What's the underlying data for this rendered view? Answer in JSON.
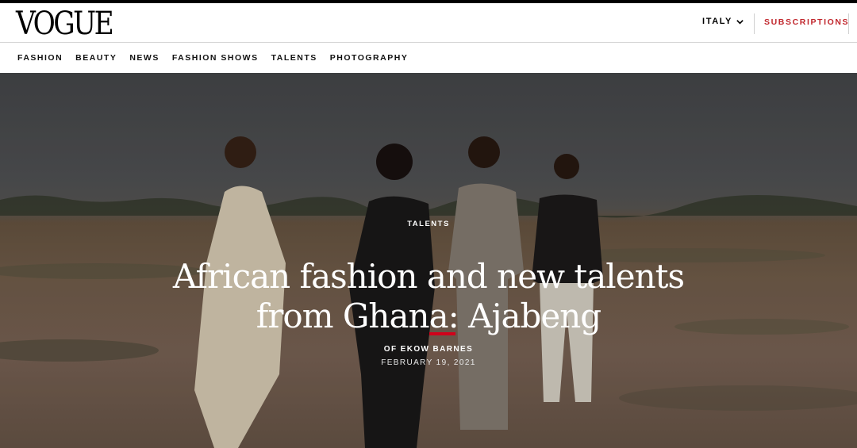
{
  "header": {
    "logo": "VOGUE",
    "region_label": "ITALY",
    "subscriptions_label": "SUBSCRIPTIONS"
  },
  "nav": {
    "items": [
      "FASHION",
      "BEAUTY",
      "NEWS",
      "FASHION SHOWS",
      "TALENTS",
      "PHOTOGRAPHY"
    ]
  },
  "article": {
    "kicker": "TALENTS",
    "title_line1": "African fashion and new talents",
    "title_line2": "from Ghana: Ajabeng",
    "byline": "OF EKOW BARNES",
    "date": "FEBRUARY 19, 2021"
  },
  "colors": {
    "accent": "#c1272d",
    "rule": "#d0021b"
  }
}
